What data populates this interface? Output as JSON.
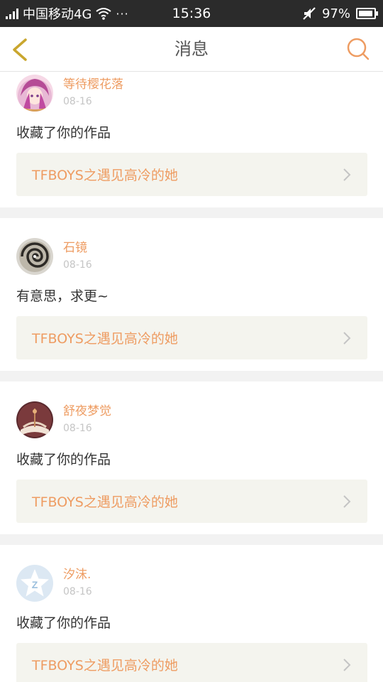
{
  "status_bar": {
    "carrier": "中国移动4G",
    "dots": "···",
    "time": "15:36",
    "battery": "97%",
    "battery_level": 0.97
  },
  "header": {
    "title": "消息",
    "back_icon": "chevron-left-icon",
    "search_icon": "search-icon"
  },
  "colors": {
    "accent": "#ee9c62",
    "back_icon": "#c9a62e",
    "link_bg": "#f4f4ee",
    "divider": "#f2f2f2"
  },
  "messages": [
    {
      "username": "等待樱花落",
      "date": "08-16",
      "text": "收藏了你的作品",
      "work_title": "TFBOYS之遇见高冷的她",
      "avatar": "anime-girl-pink-hair"
    },
    {
      "username": "石镜",
      "date": "08-16",
      "text": "有意思，求更~",
      "work_title": "TFBOYS之遇见高冷的她",
      "avatar": "swirl-photo"
    },
    {
      "username": "舒夜梦觉",
      "date": "08-16",
      "text": "收藏了你的作品",
      "work_title": "TFBOYS之遇见高冷的她",
      "avatar": "book-photo"
    },
    {
      "username": "汐沫.",
      "date": "08-16",
      "text": "收藏了你的作品",
      "work_title": "TFBOYS之遇见高冷的她",
      "avatar": "default-star-avatar"
    }
  ]
}
